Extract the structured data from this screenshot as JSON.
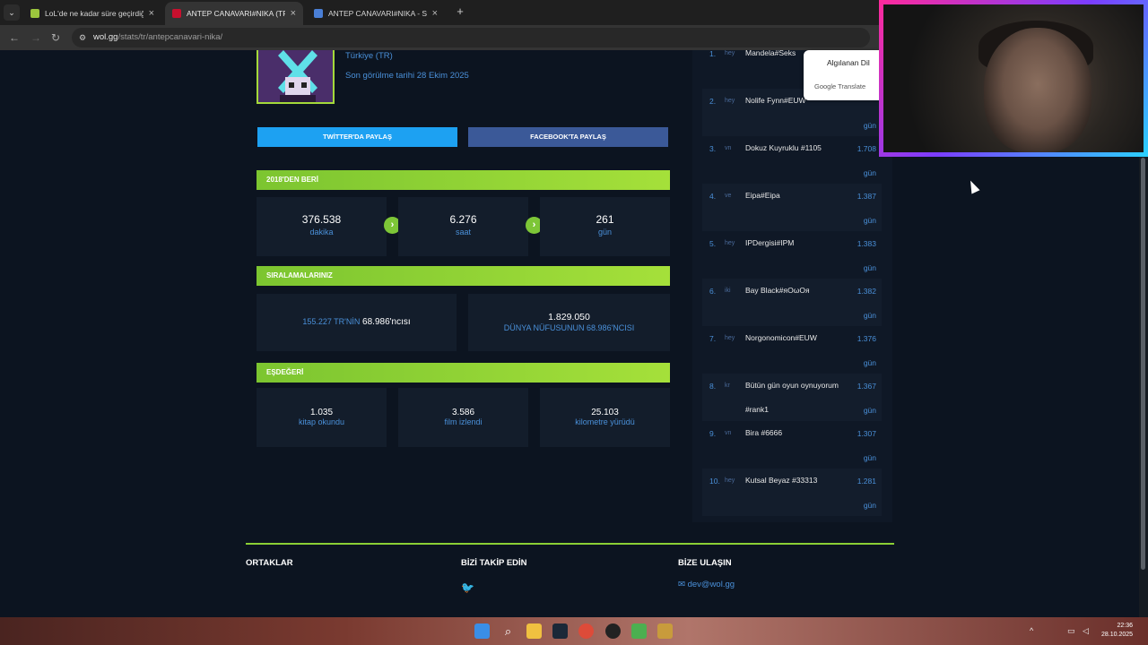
{
  "browser": {
    "tabs": [
      {
        "title": "LoL'de ne kadar süre geçirdiğin",
        "favicon_color": "#9bc53d",
        "active": false
      },
      {
        "title": "ANTEP CANAVARI#NIKA (TR) -",
        "favicon_color": "#c8102e",
        "active": true
      },
      {
        "title": "ANTEP CANAVARI#NIKA - Sum",
        "favicon_color": "#4a7fd6",
        "active": false
      }
    ],
    "url_host": "wol.gg",
    "url_path": "/stats/tr/antepcanavari-nika/"
  },
  "profile": {
    "region": "Türkiye (TR)",
    "last_seen": "Son görülme tarihi 28 Ekim 2025"
  },
  "share": {
    "twitter": "TWİTTER'DA PAYLAŞ",
    "facebook": "FACEBOOK'TA PAYLAŞ"
  },
  "since": {
    "header": "2018'DEN BERİ",
    "stats": [
      {
        "value": "376.538",
        "unit": "dakika"
      },
      {
        "value": "6.276",
        "unit": "saat"
      },
      {
        "value": "261",
        "unit": "gün"
      }
    ]
  },
  "rankings": {
    "header": "SIRALAMALARINIZ",
    "tr_prefix": "155.227 TR'NİN",
    "tr_rank": "68.986'ncısı",
    "world_total": "1.829.050",
    "world_label": "DÜNYA NÜFUSUNUN 68.986'NCISI"
  },
  "equivalent": {
    "header": "EŞDEĞERİ",
    "items": [
      {
        "value": "1.035",
        "label": "kitap okundu"
      },
      {
        "value": "3.586",
        "label": "film izlendi"
      },
      {
        "value": "25.103",
        "label": "kilometre yürüdü"
      }
    ]
  },
  "leaderboard": [
    {
      "rank": "1.",
      "tag": "hey",
      "name": "Mandela#Seks",
      "value": "",
      "unit": ""
    },
    {
      "rank": "2.",
      "tag": "hey",
      "name": "Nolife Fynn#EUW",
      "value": "",
      "unit": "gün"
    },
    {
      "rank": "3.",
      "tag": "vn",
      "name": "Dokuz Kuyruklu #1105",
      "value": "1.708",
      "unit": "gün"
    },
    {
      "rank": "4.",
      "tag": "ve",
      "name": "Eipa#Eipa",
      "value": "1.387",
      "unit": "gün"
    },
    {
      "rank": "5.",
      "tag": "hey",
      "name": "IPDergisi#IPM",
      "value": "1.383",
      "unit": "gün"
    },
    {
      "rank": "6.",
      "tag": "iki",
      "name": "Bay Black#ᴙOωOᴙ",
      "value": "1.382",
      "unit": "gün"
    },
    {
      "rank": "7.",
      "tag": "hey",
      "name": "Norgonomicon#EUW",
      "value": "1.376",
      "unit": "gün"
    },
    {
      "rank": "8.",
      "tag": "kr",
      "name": "Bütün gün oyun oynuyorum #rank1",
      "value": "1.367",
      "unit": "gün"
    },
    {
      "rank": "9.",
      "tag": "vn",
      "name": "Bira #6666",
      "value": "1.307",
      "unit": "gün"
    },
    {
      "rank": "10.",
      "tag": "hey",
      "name": "Kutsal Beyaz #33313",
      "value": "1.281",
      "unit": "gün"
    }
  ],
  "translate_popup": {
    "detected": "Algılanan Dil",
    "brand": "Google Translate"
  },
  "footer": {
    "partners": "ORTAKLAR",
    "follow": "BİZİ TAKİP EDİN",
    "contact": "BİZE ULAŞIN",
    "email": "dev@wol.gg"
  },
  "clock": {
    "time": "22:36",
    "date": "28.10.2025"
  },
  "colors": {
    "accent_green": "#8bcf35",
    "link_blue": "#4a90d9",
    "twitter": "#1da1f2",
    "facebook": "#3b5998"
  }
}
